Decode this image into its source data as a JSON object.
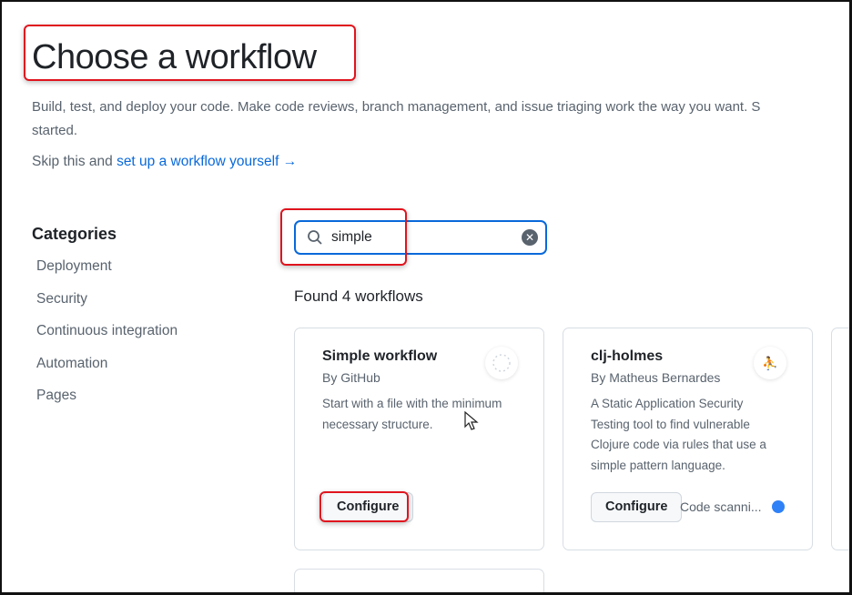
{
  "page": {
    "title": "Choose a workflow",
    "description_line1": "Build, test, and deploy your code. Make code reviews, branch management, and issue triaging work the way you want. S",
    "description_line2": "started.",
    "skip_prefix": "Skip this and",
    "skip_link": "set up a workflow yourself →"
  },
  "categories": {
    "heading": "Categories",
    "items": [
      "Deployment",
      "Security",
      "Continuous integration",
      "Automation",
      "Pages"
    ]
  },
  "search": {
    "value": "simple"
  },
  "results": {
    "found_label": "Found 4 workflows",
    "cards": [
      {
        "title": "Simple workflow",
        "author": "By GitHub",
        "description": "Start with a file with the minimum necessary structure.",
        "button": "Configure"
      },
      {
        "title": "clj-holmes",
        "author": "By Matheus Bernardes",
        "description": "A Static Application Security Testing tool to find vulnerable Clojure code via rules that use a simple pattern language.",
        "button": "Configure",
        "tag": "Code scanni..."
      }
    ]
  },
  "colors": {
    "highlight": "#e0141e",
    "link": "#0969da",
    "tag_dot": "#2f81f7"
  }
}
